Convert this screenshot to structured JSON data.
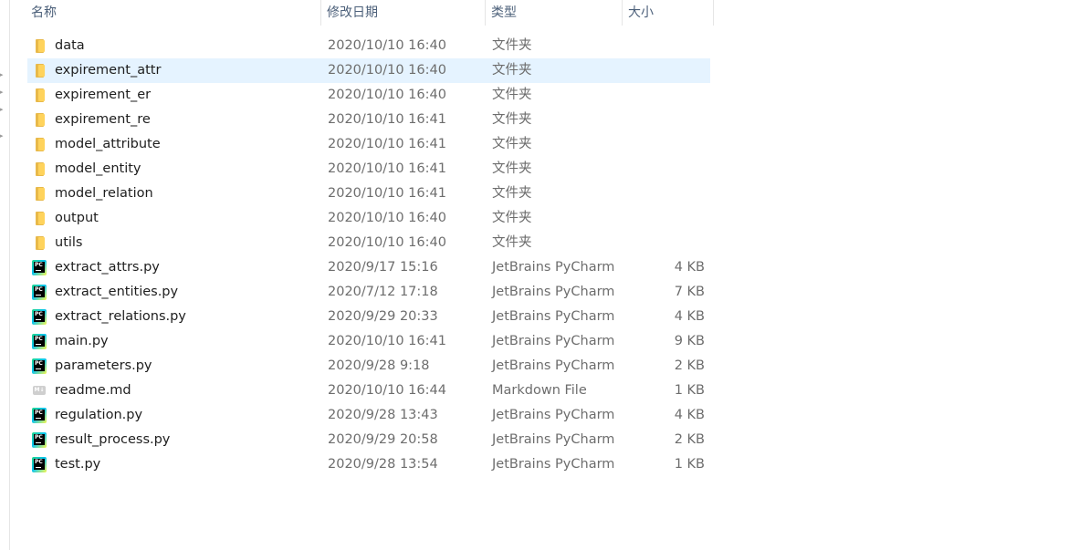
{
  "columns": {
    "name": "名称",
    "date": "修改日期",
    "type": "类型",
    "size": "大小"
  },
  "files": [
    {
      "name": "data",
      "date": "2020/10/10 16:40",
      "type": "文件夹",
      "size": "",
      "icon": "folder-icon",
      "selected": false
    },
    {
      "name": "expirement_attr",
      "date": "2020/10/10 16:40",
      "type": "文件夹",
      "size": "",
      "icon": "folder-icon",
      "selected": true
    },
    {
      "name": "expirement_er",
      "date": "2020/10/10 16:40",
      "type": "文件夹",
      "size": "",
      "icon": "folder-icon",
      "selected": false
    },
    {
      "name": "expirement_re",
      "date": "2020/10/10 16:41",
      "type": "文件夹",
      "size": "",
      "icon": "folder-icon",
      "selected": false
    },
    {
      "name": "model_attribute",
      "date": "2020/10/10 16:41",
      "type": "文件夹",
      "size": "",
      "icon": "folder-icon",
      "selected": false
    },
    {
      "name": "model_entity",
      "date": "2020/10/10 16:41",
      "type": "文件夹",
      "size": "",
      "icon": "folder-icon",
      "selected": false
    },
    {
      "name": "model_relation",
      "date": "2020/10/10 16:41",
      "type": "文件夹",
      "size": "",
      "icon": "folder-icon",
      "selected": false
    },
    {
      "name": "output",
      "date": "2020/10/10 16:40",
      "type": "文件夹",
      "size": "",
      "icon": "folder-icon",
      "selected": false
    },
    {
      "name": "utils",
      "date": "2020/10/10 16:40",
      "type": "文件夹",
      "size": "",
      "icon": "folder-icon",
      "selected": false
    },
    {
      "name": "extract_attrs.py",
      "date": "2020/9/17 15:16",
      "type": "JetBrains PyCharm",
      "size": "4 KB",
      "icon": "pycharm-icon",
      "selected": false
    },
    {
      "name": "extract_entities.py",
      "date": "2020/7/12 17:18",
      "type": "JetBrains PyCharm",
      "size": "7 KB",
      "icon": "pycharm-icon",
      "selected": false
    },
    {
      "name": "extract_relations.py",
      "date": "2020/9/29 20:33",
      "type": "JetBrains PyCharm",
      "size": "4 KB",
      "icon": "pycharm-icon",
      "selected": false
    },
    {
      "name": "main.py",
      "date": "2020/10/10 16:41",
      "type": "JetBrains PyCharm",
      "size": "9 KB",
      "icon": "pycharm-icon",
      "selected": false
    },
    {
      "name": "parameters.py",
      "date": "2020/9/28 9:18",
      "type": "JetBrains PyCharm",
      "size": "2 KB",
      "icon": "pycharm-icon",
      "selected": false
    },
    {
      "name": "readme.md",
      "date": "2020/10/10 16:44",
      "type": "Markdown File",
      "size": "1 KB",
      "icon": "markdown-icon",
      "selected": false
    },
    {
      "name": "regulation.py",
      "date": "2020/9/28 13:43",
      "type": "JetBrains PyCharm",
      "size": "4 KB",
      "icon": "pycharm-icon",
      "selected": false
    },
    {
      "name": "result_process.py",
      "date": "2020/9/29 20:58",
      "type": "JetBrains PyCharm",
      "size": "2 KB",
      "icon": "pycharm-icon",
      "selected": false
    },
    {
      "name": "test.py",
      "date": "2020/9/28 13:54",
      "type": "JetBrains PyCharm",
      "size": "1 KB",
      "icon": "pycharm-icon",
      "selected": false
    }
  ],
  "colors": {
    "selected_row": "#e5f3ff",
    "header_text": "#4c607a",
    "folder": "#ffd35c"
  }
}
